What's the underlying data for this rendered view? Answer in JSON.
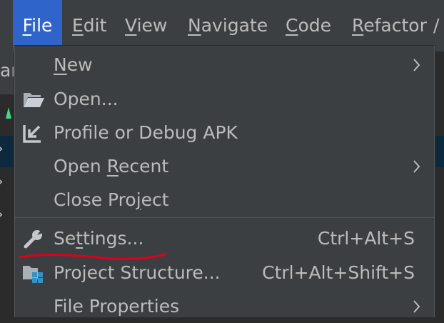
{
  "menubar": {
    "items": [
      {
        "label": "File",
        "mnemonic": "F",
        "rest": "ile",
        "active": true
      },
      {
        "label": "Edit",
        "mnemonic": "E",
        "rest": "dit"
      },
      {
        "label": "View",
        "mnemonic": "V",
        "rest": "iew"
      },
      {
        "label": "Navigate",
        "mnemonic": "N",
        "rest": "avigate"
      },
      {
        "label": "Code",
        "mnemonic": "C",
        "rest": "ode"
      },
      {
        "label": "Refactor",
        "mnemonic": "R",
        "rest": "efactor"
      }
    ],
    "overflow": "/"
  },
  "background": {
    "fragment_text": "ar"
  },
  "file_menu": {
    "items": [
      {
        "label": "New",
        "pre": "",
        "mn": "N",
        "post": "ew",
        "submenu": true
      },
      {
        "label": "Open...",
        "pre": "",
        "mn": "",
        "post": "Open...",
        "icon": "folder-open-icon"
      },
      {
        "label": "Profile or Debug APK",
        "pre": "",
        "mn": "",
        "post": "Profile or Debug APK",
        "icon": "import-arrow-icon"
      },
      {
        "label": "Open Recent",
        "pre": "Open ",
        "mn": "R",
        "post": "ecent",
        "submenu": true
      },
      {
        "label": "Close Project",
        "pre": "Close Pro",
        "mn": "j",
        "post": "ect"
      },
      {
        "label": "Settings...",
        "pre": "Se",
        "mn": "t",
        "post": "tings...",
        "shortcut": "Ctrl+Alt+S",
        "icon": "wrench-icon"
      },
      {
        "label": "Project Structure...",
        "pre": "Project Structure...",
        "mn": "",
        "post": "",
        "shortcut": "Ctrl+Alt+Shift+S",
        "icon": "project-structure-icon"
      },
      {
        "label": "File Properties",
        "pre": "File Properties",
        "mn": "",
        "post": "",
        "submenu": true
      }
    ]
  },
  "colors": {
    "menubar_bg": "#3c3f41",
    "active_menu_bg": "#2f65ca",
    "text": "#bbbbbb",
    "annotation_red": "#e0001b"
  }
}
